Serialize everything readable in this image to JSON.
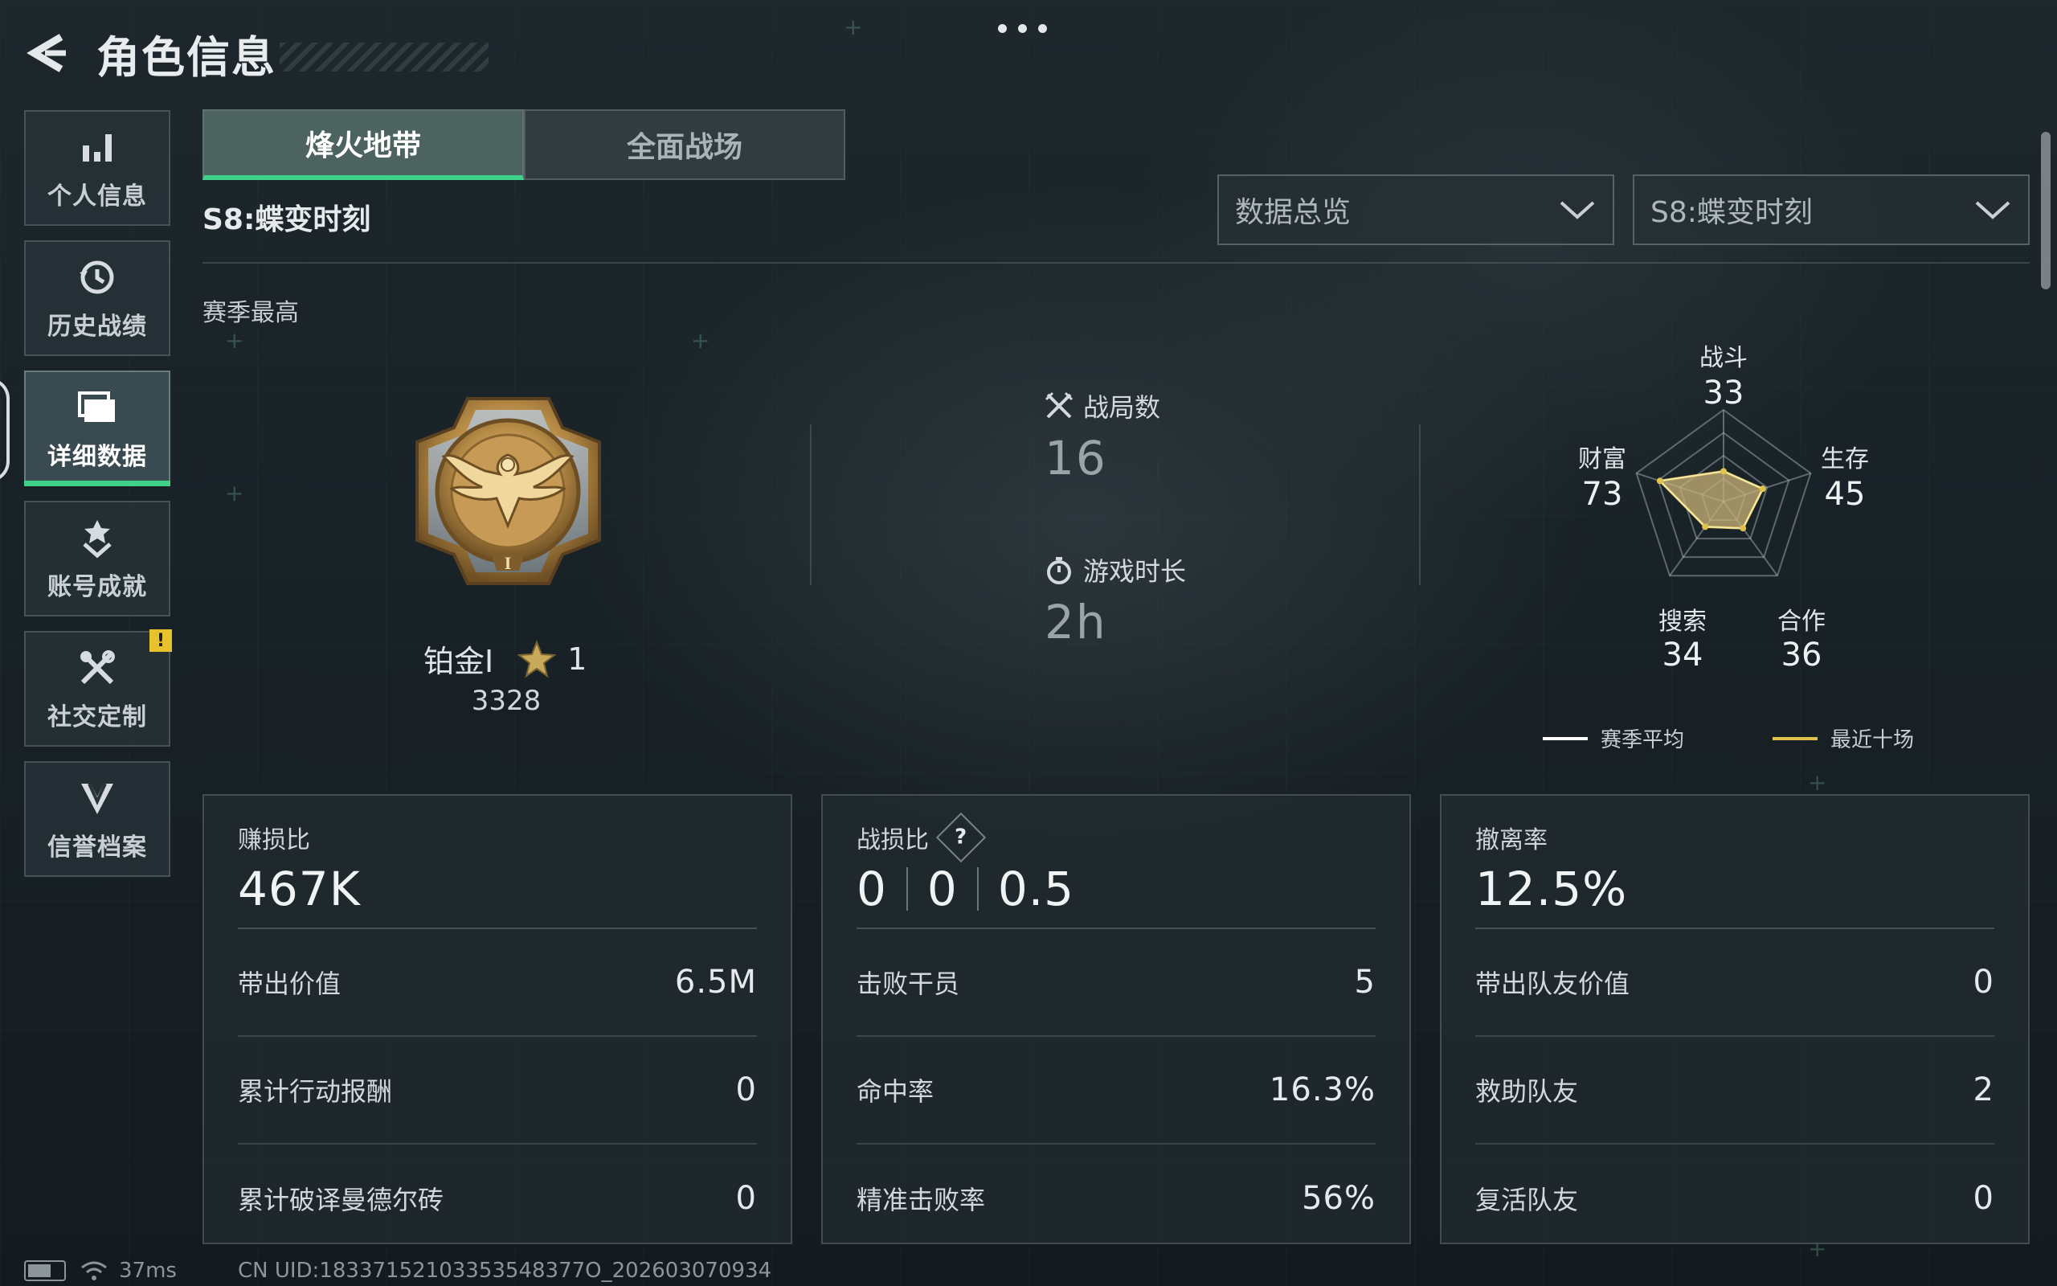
{
  "header": {
    "title": "角色信息",
    "back_icon": "back-arrow-icon",
    "more_icon": "more-dots-icon"
  },
  "sidebar": {
    "items": [
      {
        "label": "个人信息",
        "icon": "bar-chart-icon",
        "active": false
      },
      {
        "label": "历史战绩",
        "icon": "history-clock-icon",
        "active": false
      },
      {
        "label": "详细数据",
        "icon": "folder-icon",
        "active": true
      },
      {
        "label": "账号成就",
        "icon": "medal-star-icon",
        "active": false
      },
      {
        "label": "社交定制",
        "icon": "tools-icon",
        "active": false,
        "badge": "!"
      },
      {
        "label": "信誉档案",
        "icon": "shield-chevron-icon",
        "active": false
      }
    ]
  },
  "tabs": [
    {
      "label": "烽火地带",
      "active": true
    },
    {
      "label": "全面战场",
      "active": false
    }
  ],
  "season": {
    "title": "S8:蝶变时刻",
    "best_label": "赛季最高"
  },
  "filters": {
    "view": "数据总览",
    "season": "S8:蝶变时刻"
  },
  "rank": {
    "name": "铂金Ⅰ",
    "stars": "1",
    "score": "3328"
  },
  "overview": {
    "matches_label": "战局数",
    "matches_value": "16",
    "duration_label": "游戏时长",
    "duration_value": "2h"
  },
  "radar": {
    "labels": {
      "combat": "战斗",
      "survival": "生存",
      "teamwork": "合作",
      "search": "搜索",
      "wealth": "财富"
    },
    "values": {
      "combat": "33",
      "survival": "45",
      "teamwork": "36",
      "search": "34",
      "wealth": "73"
    },
    "legend": {
      "season_avg": "赛季平均",
      "recent_ten": "最近十场"
    },
    "colors": {
      "season_avg": "#ffffff",
      "recent_ten": "#e0c34c",
      "fill": "#c9b37a"
    }
  },
  "cards": {
    "profit": {
      "title": "赚损比",
      "value": "467K",
      "rows": [
        {
          "label": "带出价值",
          "value": "6.5M"
        },
        {
          "label": "累计行动报酬",
          "value": "0"
        },
        {
          "label": "累计破译曼德尔砖",
          "value": "0"
        }
      ]
    },
    "combat": {
      "title": "战损比",
      "help": "?",
      "values": [
        "0",
        "0",
        "0.5"
      ],
      "rows": [
        {
          "label": "击败干员",
          "value": "5"
        },
        {
          "label": "命中率",
          "value": "16.3%"
        },
        {
          "label": "精准击败率",
          "value": "56%"
        }
      ]
    },
    "extract": {
      "title": "撤离率",
      "value": "12.5%",
      "rows": [
        {
          "label": "带出队友价值",
          "value": "0"
        },
        {
          "label": "救助队友",
          "value": "2"
        },
        {
          "label": "复活队友",
          "value": "0"
        }
      ]
    }
  },
  "footer": {
    "ping": "37ms",
    "uid": "CN UID:18337152103353548377O_202603070934"
  },
  "accent": "#3fd18a"
}
